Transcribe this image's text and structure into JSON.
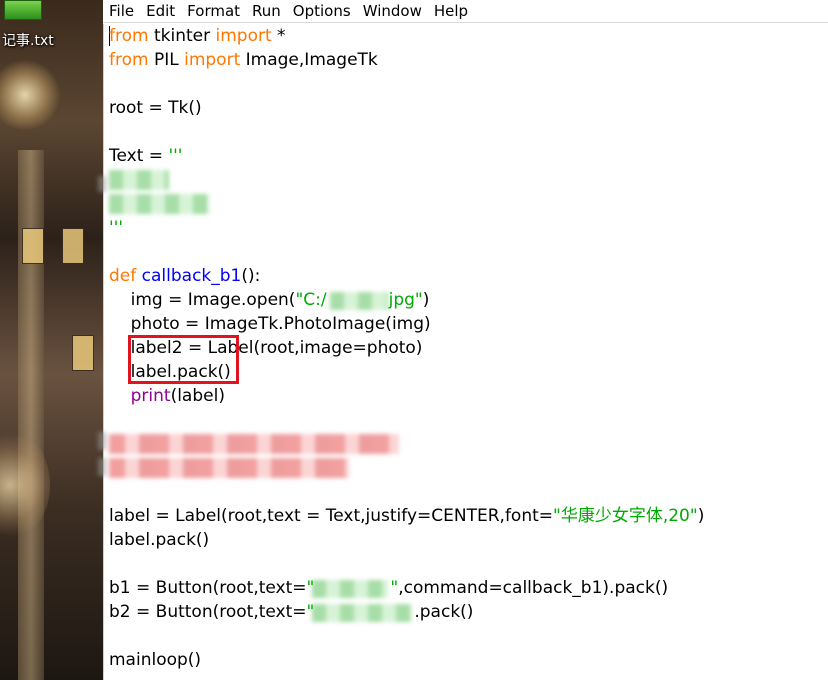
{
  "desktop": {
    "file_icon": "notepad-file-icon",
    "file_label": "记事.txt"
  },
  "menubar": {
    "items": [
      "File",
      "Edit",
      "Format",
      "Run",
      "Options",
      "Window",
      "Help"
    ]
  },
  "code": {
    "l1": {
      "kw1": "from",
      "t1": " tkinter ",
      "kw2": "import",
      "t2": " *"
    },
    "l2": {
      "kw1": "from",
      "t1": " PIL ",
      "kw2": "import",
      "t2": " Image,ImageTk"
    },
    "l4": "root = Tk()",
    "l6": {
      "t1": "Text = ",
      "s1": "'''"
    },
    "l9": {
      "s1": "'''"
    },
    "l12": {
      "kw1": "def",
      "sp": " ",
      "fn": "callback_b1",
      "t1": "():"
    },
    "l13": {
      "t1": "    img = Image.open(",
      "s1": "\"C:/",
      "s2": "jpg\"",
      "t2": ")"
    },
    "l14": "    photo = ImageTk.PhotoImage(img)",
    "l15": "    label2 = Label(root,image=photo)",
    "l16": "    label.pack()",
    "l17": {
      "sp": "    ",
      "bi": "print",
      "t1": "(label)"
    },
    "l22": {
      "t1": "label = Label(root,text = Text,justify=CENTER,font=",
      "s1": "\"华康少女字体,20\"",
      "t2": ")"
    },
    "l23": "label.pack()",
    "l25": {
      "t1": "b1 = Button(root,text=",
      "s1": "\"",
      "s2": "\"",
      "t2": ",command=callback_b1).pack()"
    },
    "l26": {
      "t1": "b2 = Button(root,text=",
      "s1": "\"",
      "t2": ".pack()"
    },
    "l28": "mainloop()"
  },
  "colors": {
    "keyword": "#ff7700",
    "string": "#00aa00",
    "definition": "#0000ff",
    "builtin": "#900090",
    "highlight_box": "#e0141e"
  }
}
